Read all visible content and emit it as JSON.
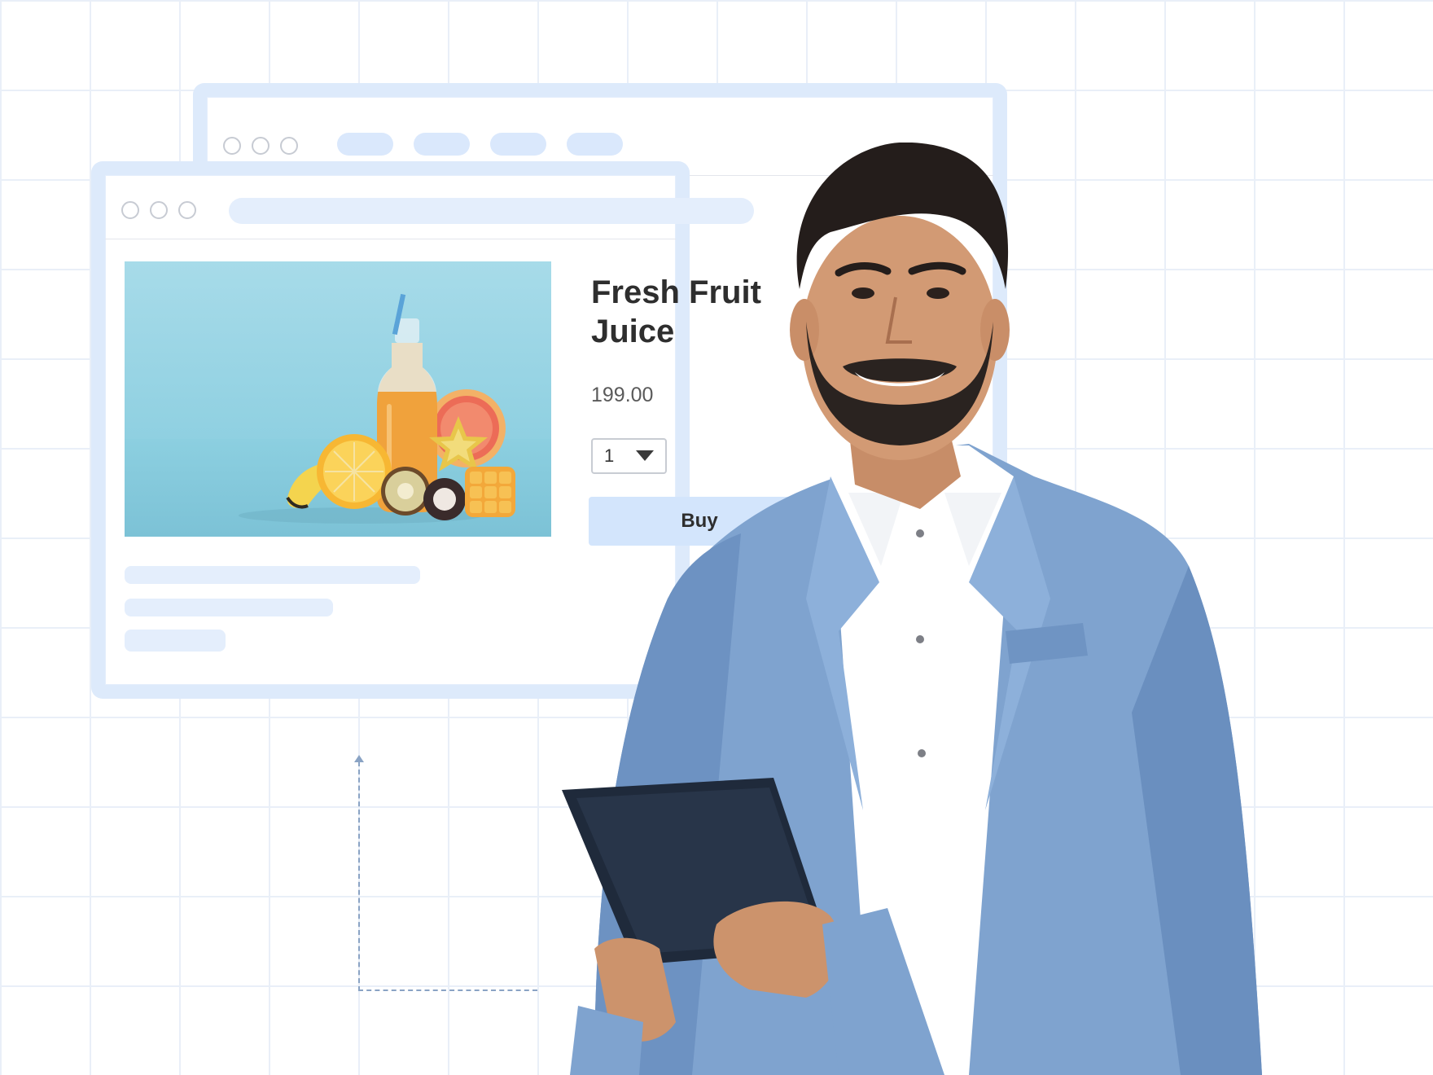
{
  "back_window": {
    "tabs": [
      "",
      "",
      "",
      ""
    ]
  },
  "product": {
    "title": "Fresh Fruit Juice",
    "price": "199.00",
    "quantity": "1",
    "buy_label": "Buy"
  },
  "colors": {
    "accent_light": "#d3e5fc",
    "window_border": "#ddeafb",
    "grid": "#e9eff8",
    "jacket": "#7fa3cf",
    "tablet": "#1f2a3b"
  },
  "icons": {
    "quantity_dropdown": "chevron-down-icon"
  }
}
